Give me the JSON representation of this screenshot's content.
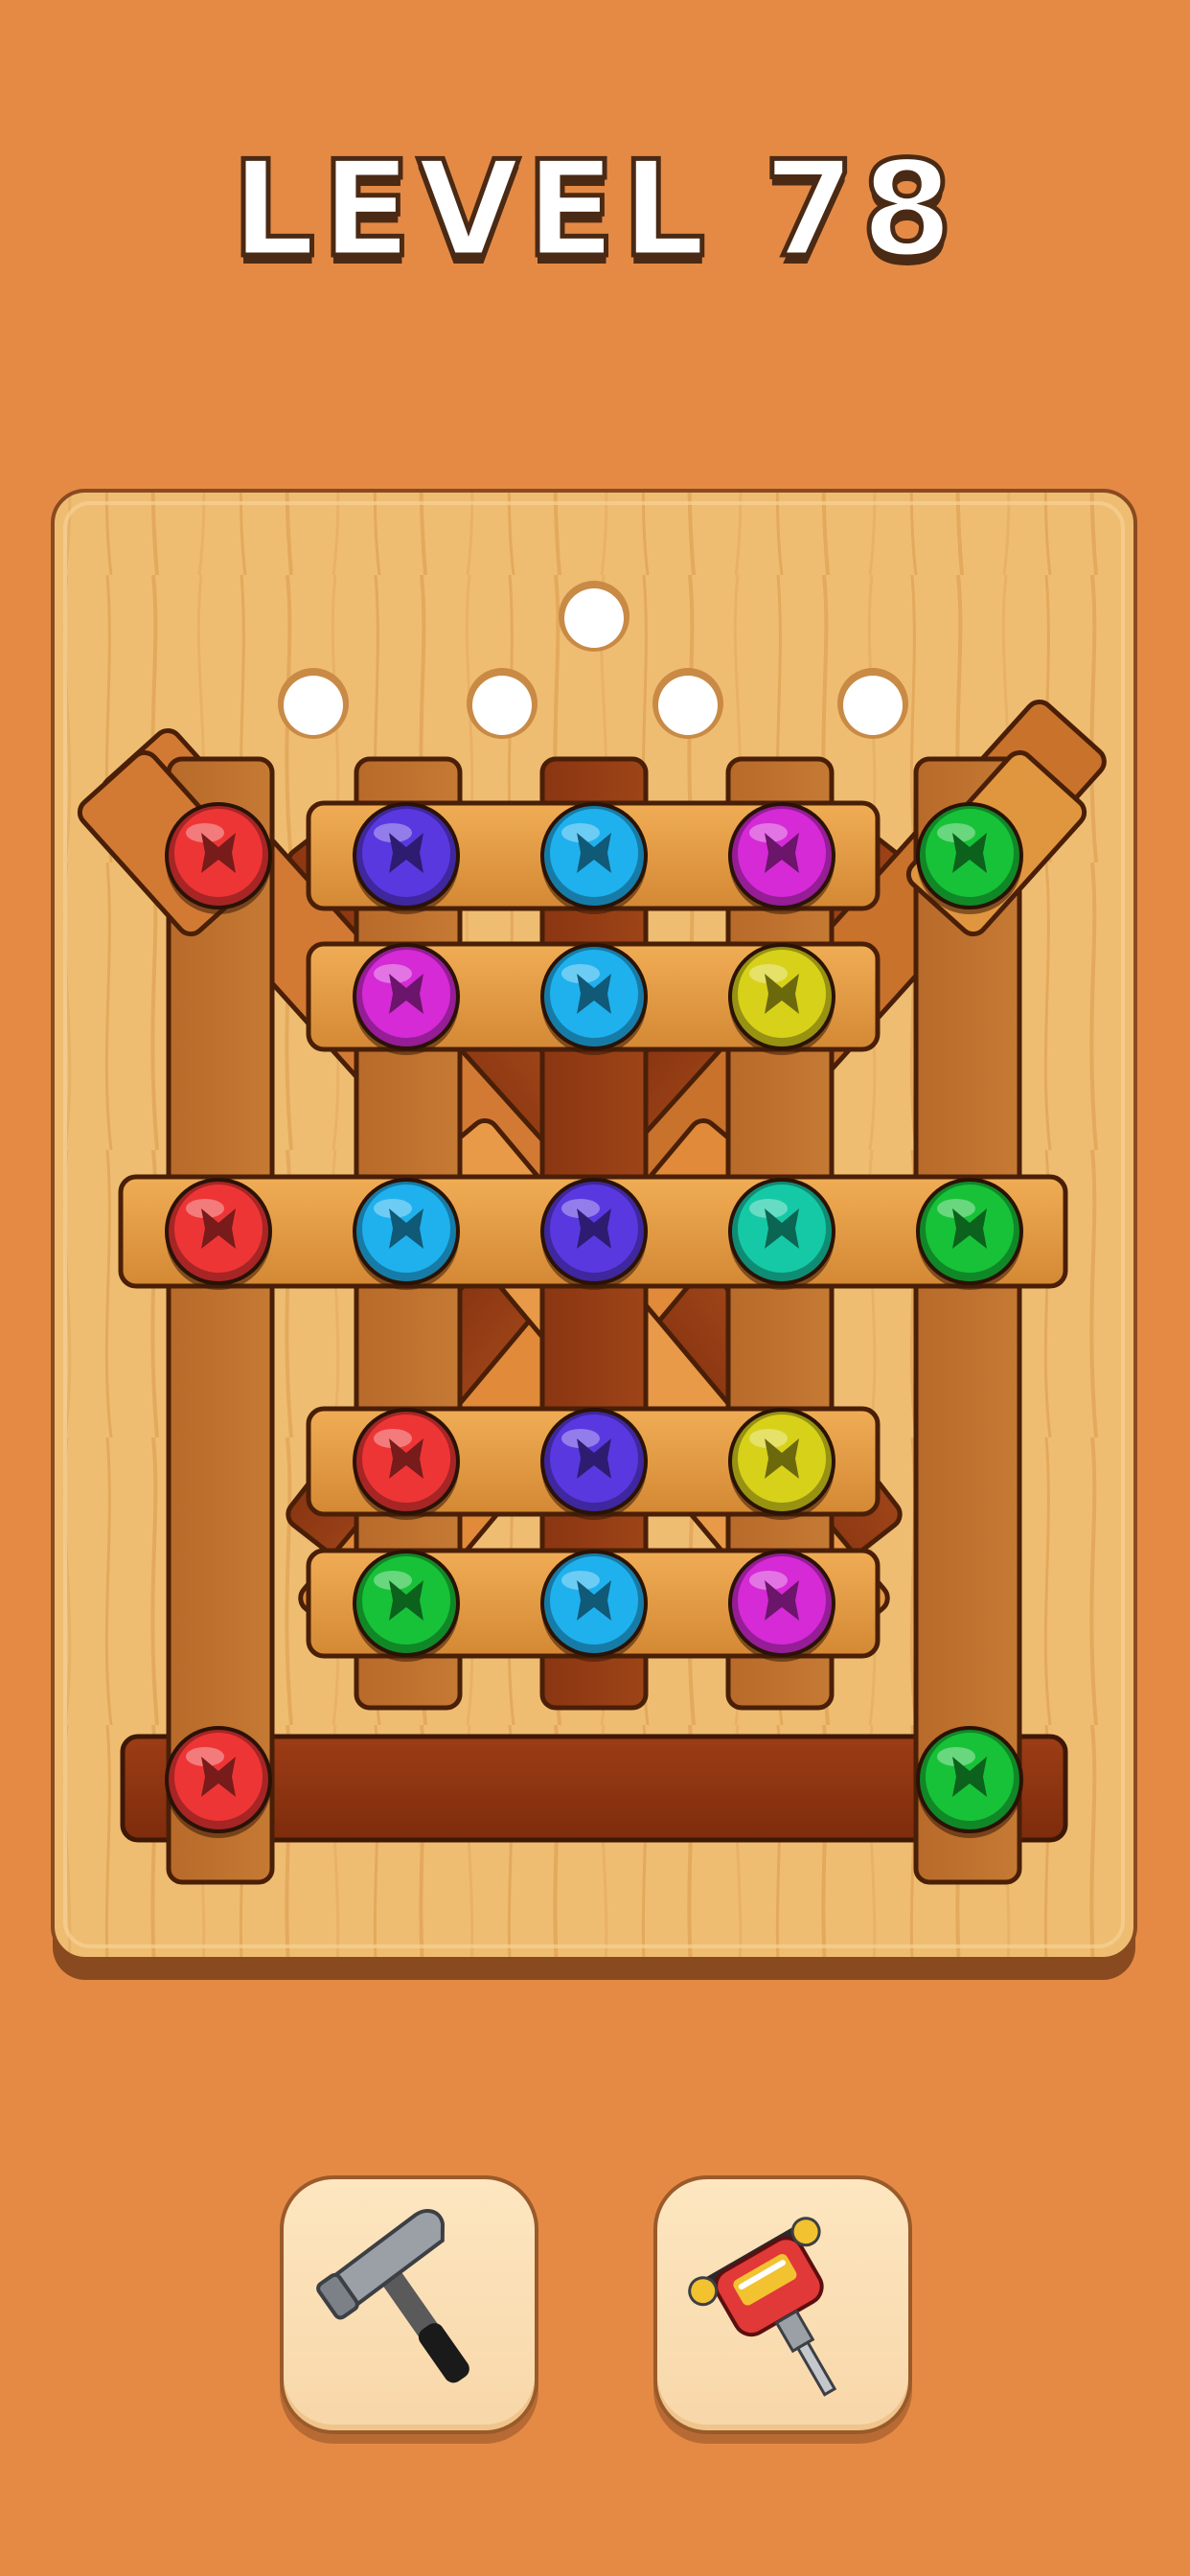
{
  "level": {
    "label": "LEVEL 78"
  },
  "colors": {
    "background": "#e58a45",
    "board": "#efbd72",
    "board_edge": "#8a4a20",
    "plank_light": "#e8a24c",
    "plank_mid": "#c87a2c",
    "plank_dark": "#8f3a14",
    "screw_red": "#ee3535",
    "screw_indigo": "#5a38e0",
    "screw_cyan": "#1fb1ee",
    "screw_magenta": "#d52ad6",
    "screw_yellow": "#d8d11a",
    "screw_teal": "#16c9a6",
    "screw_green": "#17c238"
  },
  "board": {
    "empty_holes": 5,
    "screws": [
      {
        "row": 1,
        "colors": [
          "red",
          "indigo",
          "cyan",
          "magenta",
          "green"
        ]
      },
      {
        "row": 2,
        "colors": [
          "magenta",
          "cyan",
          "yellow"
        ]
      },
      {
        "row": 3,
        "colors": [
          "red",
          "cyan",
          "indigo",
          "teal",
          "green"
        ]
      },
      {
        "row": 4,
        "colors": [
          "red",
          "indigo",
          "yellow"
        ]
      },
      {
        "row": 5,
        "colors": [
          "green",
          "cyan",
          "magenta"
        ]
      },
      {
        "row": 6,
        "colors": [
          "red",
          "green"
        ]
      }
    ]
  },
  "tools": [
    {
      "name": "hammer",
      "icon": "hammer-icon"
    },
    {
      "name": "drill",
      "icon": "drill-icon"
    }
  ]
}
